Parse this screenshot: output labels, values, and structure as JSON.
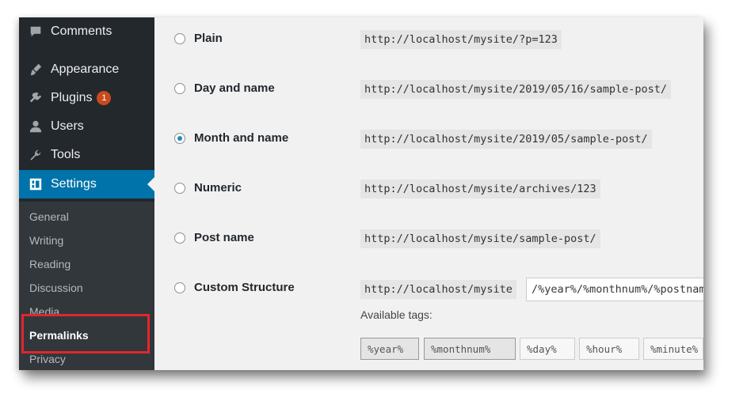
{
  "sidebar": {
    "items": [
      {
        "label": "Comments",
        "icon": "comment-icon"
      },
      {
        "label": "Appearance",
        "icon": "paintbrush-icon"
      },
      {
        "label": "Plugins",
        "icon": "plug-icon",
        "badge": "1"
      },
      {
        "label": "Users",
        "icon": "users-icon"
      },
      {
        "label": "Tools",
        "icon": "wrench-icon"
      },
      {
        "label": "Settings",
        "icon": "settings-icon"
      }
    ],
    "submenu": [
      "General",
      "Writing",
      "Reading",
      "Discussion",
      "Media",
      "Permalinks",
      "Privacy"
    ]
  },
  "permalinks": {
    "options": [
      {
        "label": "Plain",
        "url": "http://localhost/mysite/?p=123",
        "checked": false
      },
      {
        "label": "Day and name",
        "url": "http://localhost/mysite/2019/05/16/sample-post/",
        "checked": false
      },
      {
        "label": "Month and name",
        "url": "http://localhost/mysite/2019/05/sample-post/",
        "checked": true
      },
      {
        "label": "Numeric",
        "url": "http://localhost/mysite/archives/123",
        "checked": false
      },
      {
        "label": "Post name",
        "url": "http://localhost/mysite/sample-post/",
        "checked": false
      },
      {
        "label": "Custom Structure",
        "url": "http://localhost/mysite",
        "checked": false
      }
    ],
    "custom_value": "/%year%/%monthnum%/%postname%/",
    "available_tags_label": "Available tags:",
    "tags": [
      "%year%",
      "%monthnum%",
      "%day%",
      "%hour%",
      "%minute%"
    ]
  },
  "colors": {
    "sidebar": "#23282d",
    "active": "#0073aa",
    "badge": "#ca4a1f",
    "highlight": "#e3262b"
  }
}
